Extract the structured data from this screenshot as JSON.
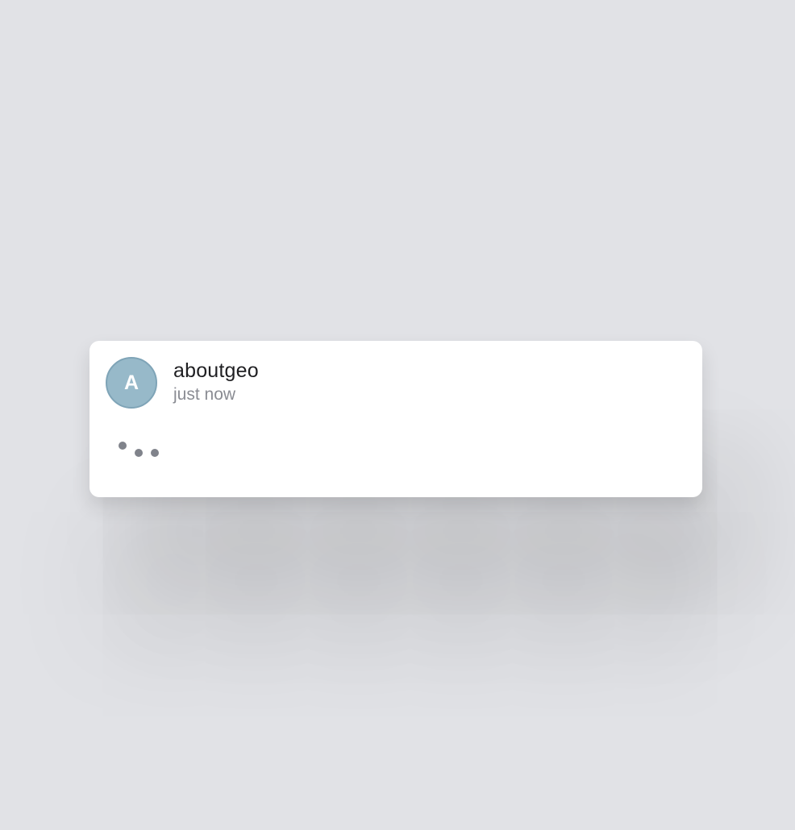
{
  "message": {
    "avatar_initial": "A",
    "avatar_color": "#97b9c9",
    "username": "aboutgeo",
    "timestamp": "just now",
    "status": "typing"
  },
  "colors": {
    "background": "#e1e2e6",
    "card": "#ffffff",
    "username": "#1f1f22",
    "timestamp": "#8a8c93",
    "typing_dots": "#80838b"
  }
}
